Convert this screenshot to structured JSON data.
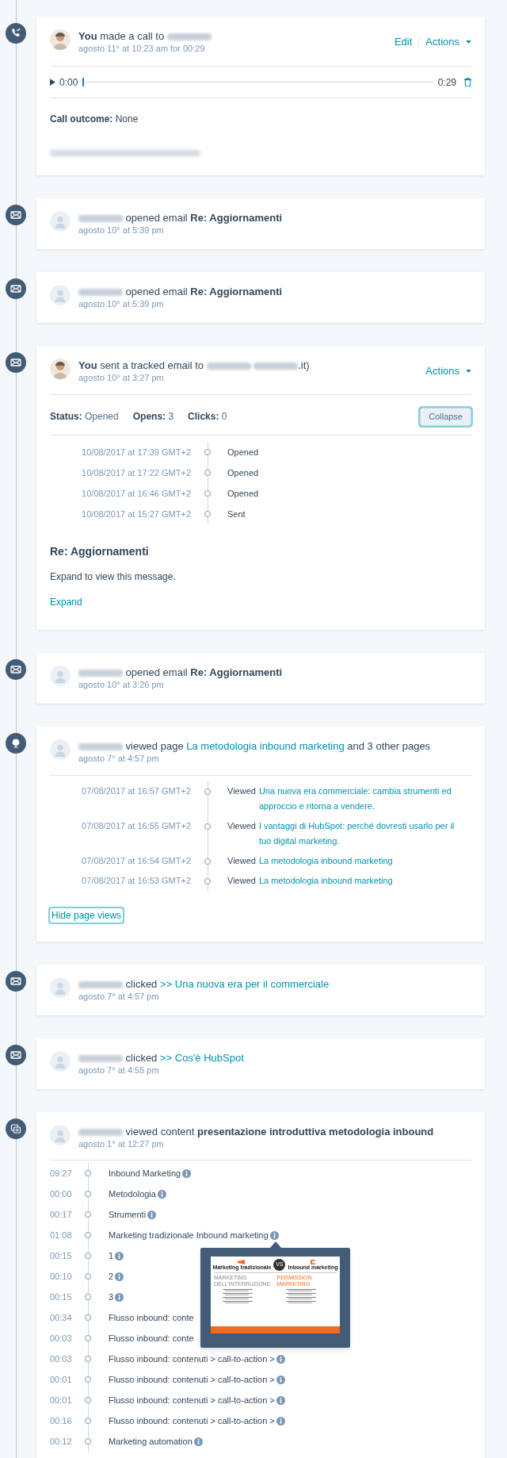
{
  "events": [
    {
      "kind": "call",
      "title": [
        {
          "kind": "bold",
          "text": "You"
        },
        {
          "kind": "text",
          "text": "made a call to"
        },
        {
          "kind": "redacted"
        }
      ],
      "date": "agosto 11° at 10:23 am for 00:29",
      "actions": [
        {
          "kind": "link",
          "label": "Edit"
        },
        {
          "kind": "menu",
          "label": "Actions"
        }
      ],
      "audio": {
        "start": "0:00",
        "end": "0:29",
        "level": 0
      },
      "outcome": {
        "label": "Call outcome:",
        "value": "None"
      },
      "notes_redacted": true
    },
    {
      "kind": "simple",
      "title": [
        {
          "kind": "redacted"
        },
        {
          "kind": "text",
          "text": "opened email"
        },
        {
          "kind": "bold",
          "text": "Re: Aggiornamenti"
        }
      ],
      "date": "agosto 10° at 5:39 pm"
    },
    {
      "kind": "simple",
      "title": [
        {
          "kind": "redacted"
        },
        {
          "kind": "text",
          "text": "opened email"
        },
        {
          "kind": "bold",
          "text": "Re: Aggiornamenti"
        }
      ],
      "date": "agosto 10° at 5:39 pm"
    },
    {
      "kind": "tracked",
      "title": [
        {
          "kind": "bold",
          "text": "You"
        },
        {
          "kind": "text",
          "text": "sent a tracked email to"
        },
        {
          "kind": "redacted"
        },
        {
          "kind": "redacted"
        },
        {
          "kind": "suffix",
          "text": ".it)"
        }
      ],
      "date": "agosto 10° at 3:27 pm",
      "actions": [
        {
          "kind": "menu",
          "label": "Actions"
        }
      ],
      "stats": [
        {
          "label": "Status:",
          "value": "Opened"
        },
        {
          "label": "Opens:",
          "value": "3"
        },
        {
          "label": "Clicks:",
          "value": "0"
        }
      ],
      "button": {
        "label": "Collapse",
        "focused": true
      },
      "log": [
        {
          "time": "10/08/2017 at 17:39 GMT+2",
          "text": "Opened"
        },
        {
          "time": "10/08/2017 at 17:22 GMT+2",
          "text": "Opened"
        },
        {
          "time": "10/08/2017 at 16:46 GMT+2",
          "text": "Opened"
        },
        {
          "time": "10/08/2017 at 15:27 GMT+2",
          "text": "Sent"
        }
      ],
      "subject": "Re: Aggiornamenti",
      "preview": "Expand to view this message.",
      "expand": "Expand"
    },
    {
      "kind": "simple",
      "title": [
        {
          "kind": "redacted"
        },
        {
          "kind": "text",
          "text": "opened email"
        },
        {
          "kind": "bold",
          "text": "Re: Aggiornamenti"
        }
      ],
      "date": "agosto 10° at 3:26 pm"
    },
    {
      "kind": "pages",
      "title": [
        {
          "kind": "redacted"
        },
        {
          "kind": "text",
          "text": "viewed page"
        },
        {
          "kind": "link",
          "text": "La metodologia inbound marketing"
        },
        {
          "kind": "text",
          "text": "and 3 other pages"
        }
      ],
      "date": "agosto 7° at 4:57 pm",
      "log": [
        {
          "time": "07/08/2017 at 16:57 GMT+2",
          "prefix": "Viewed",
          "link": "Una nuova era commerciale: cambia strumenti ed approccio e ritorna a vendere."
        },
        {
          "time": "07/08/2017 at 16:55 GMT+2",
          "prefix": "Viewed",
          "link": "I vantaggi di HubSpot: perché dovresti usarlo per il tuo digital marketing."
        },
        {
          "time": "07/08/2017 at 16:54 GMT+2",
          "prefix": "Viewed",
          "link": "La metodologia inbound marketing"
        },
        {
          "time": "07/08/2017 at 16:53 GMT+2",
          "prefix": "Viewed",
          "link": "La metodologia inbound marketing"
        }
      ],
      "button": {
        "label": "Hide page views",
        "focused": true
      }
    },
    {
      "kind": "simple",
      "title": [
        {
          "kind": "redacted"
        },
        {
          "kind": "text",
          "text": "clicked"
        },
        {
          "kind": "link",
          "text": ">> Una nuova era per il commerciale"
        }
      ],
      "date": "agosto 7° at 4:57 pm"
    },
    {
      "kind": "simple",
      "title": [
        {
          "kind": "redacted"
        },
        {
          "kind": "text",
          "text": "clicked"
        },
        {
          "kind": "link",
          "text": ">> Cos'è HubSpot"
        }
      ],
      "date": "agosto 7° at 4:55 pm"
    },
    {
      "kind": "slides",
      "title": [
        {
          "kind": "redacted"
        },
        {
          "kind": "text",
          "text": "viewed content"
        },
        {
          "kind": "bold",
          "text": "presentazione introduttiva metodologia inbound"
        }
      ],
      "date": "agosto 1° at 12:27 pm",
      "slides": [
        {
          "time": "09:27",
          "text": "Inbound Marketing",
          "info": true
        },
        {
          "time": "00:00",
          "text": "Metodologia",
          "info": true
        },
        {
          "time": "00:17",
          "text": "Strumenti",
          "info": true
        },
        {
          "time": "01:08",
          "text": "Marketing tradizionale Inbound marketing",
          "info": true
        },
        {
          "time": "00:15",
          "text": "1",
          "info": true
        },
        {
          "time": "00:10",
          "text": "2",
          "info": true
        },
        {
          "time": "00:15",
          "text": "3",
          "info": true
        },
        {
          "time": "00:34",
          "text": "Flusso inbound: conte",
          "info": false
        },
        {
          "time": "00:03",
          "text": "Flusso inbound: conte",
          "info": false
        },
        {
          "time": "00:03",
          "text": "Flusso inbound: contenuti > call-to-action >",
          "info": true
        },
        {
          "time": "00:01",
          "text": "Flusso inbound: contenuti > call-to-action >",
          "info": true
        },
        {
          "time": "00:01",
          "text": "Flusso inbound: contenuti > call-to-action >",
          "info": true
        },
        {
          "time": "00:16",
          "text": "Flusso inbound: contenuti > call-to-action >",
          "info": true
        },
        {
          "time": "00:12",
          "text": "Marketing automation",
          "info": true
        }
      ],
      "preview": {
        "left_title": "Marketing tradizionale",
        "vs": "VS",
        "right_title": "Inbound marketing",
        "left_heading": "MARKETING DELL'INTERRUZIONE",
        "right_heading": "PERMISSION MARKETING"
      }
    }
  ]
}
